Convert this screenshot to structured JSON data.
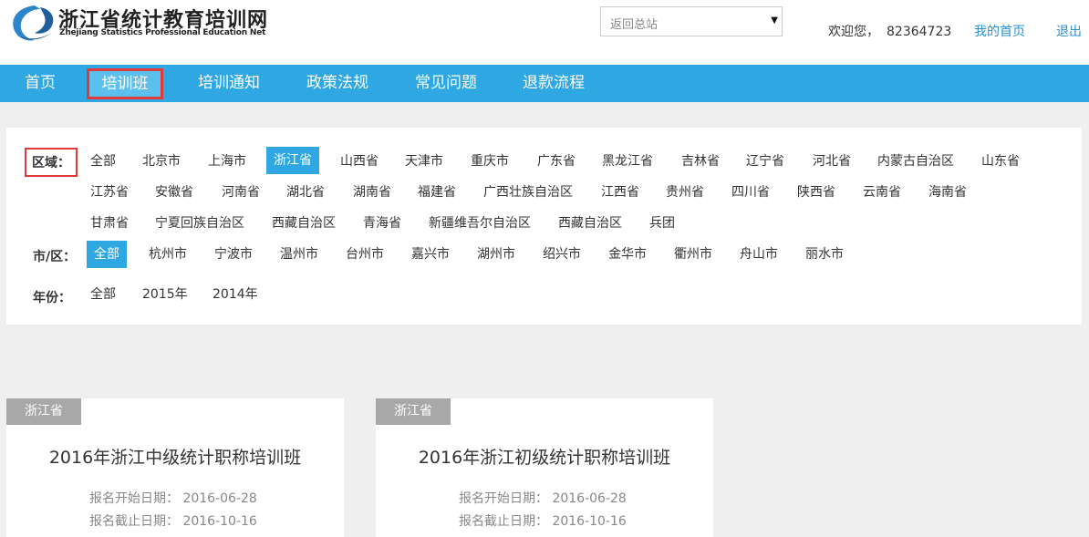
{
  "header": {
    "logo_cn": "浙江省统计教育培训网",
    "logo_en": "Zhejiang Statistics Professional Education Net",
    "select_value": "返回总站",
    "welcome": "欢迎您，",
    "user_id": "82364723",
    "my_home": "我的首页",
    "logout": "退出"
  },
  "nav": {
    "items": [
      {
        "label": "首页"
      },
      {
        "label": "培训班"
      },
      {
        "label": "培训通知"
      },
      {
        "label": "政策法规"
      },
      {
        "label": "常见问题"
      },
      {
        "label": "退款流程"
      }
    ]
  },
  "filter": {
    "region_label": "区域：",
    "region_options": [
      "全部",
      "北京市",
      "上海市",
      "浙江省",
      "山西省",
      "天津市",
      "重庆市",
      "广东省",
      "黑龙江省",
      "吉林省",
      "辽宁省",
      "河北省",
      "内蒙古自治区",
      "山东省",
      "江苏省",
      "安徽省",
      "河南省",
      "湖北省",
      "湖南省",
      "福建省",
      "广西壮族自治区",
      "江西省",
      "贵州省",
      "四川省",
      "陕西省",
      "云南省",
      "海南省",
      "甘肃省",
      "宁夏回族自治区",
      "西藏自治区",
      "青海省",
      "新疆维吾尔自治区",
      "西藏自治区",
      "兵团"
    ],
    "city_label": "市/区：",
    "city_options": [
      "全部",
      "杭州市",
      "宁波市",
      "温州市",
      "台州市",
      "嘉兴市",
      "湖州市",
      "绍兴市",
      "金华市",
      "衢州市",
      "舟山市",
      "丽水市"
    ],
    "year_label": "年份：",
    "year_options": [
      "全部",
      "2015年",
      "2014年"
    ]
  },
  "cards": [
    {
      "tag": "浙江省",
      "title": "2016年浙江中级统计职称培训班",
      "start_label": "报名开始日期：",
      "start": "2016-06-28",
      "end_label": "报名截止日期：",
      "end": "2016-10-16"
    },
    {
      "tag": "浙江省",
      "title": "2016年浙江初级统计职称培训班",
      "start_label": "报名开始日期：",
      "start": "2016-06-28",
      "end_label": "报名截止日期：",
      "end": "2016-10-16"
    }
  ],
  "colors": {
    "accent": "#2fa7e2",
    "highlight": "#e23a3a",
    "tag": "#a8a8a8"
  }
}
